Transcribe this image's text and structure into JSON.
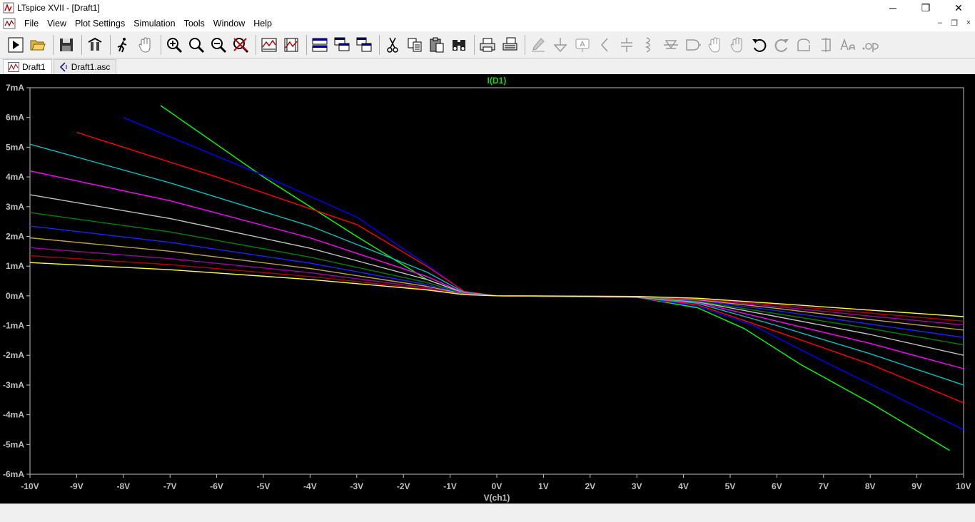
{
  "window": {
    "title": "LTspice XVII - [Draft1]",
    "minimize": "─",
    "maximize": "❐",
    "close": "✕"
  },
  "menubar": {
    "items": [
      "File",
      "View",
      "Plot Settings",
      "Simulation",
      "Tools",
      "Window",
      "Help"
    ],
    "mdi_min": "–",
    "mdi_restore": "❐",
    "mdi_close": "×"
  },
  "toolbar": {
    "icons": [
      "run-icon",
      "open-icon",
      "save-icon",
      "control-panel-icon",
      "halt-icon",
      "pan-icon",
      "zoom-in-icon",
      "zoom-area-icon",
      "zoom-out-icon",
      "zoom-fit-icon",
      "autorange-icon",
      "manual-limits-icon",
      "tile-horizontal-icon",
      "cascade-icon",
      "tile-vertical-icon",
      "cut-icon",
      "copy-icon",
      "paste-icon",
      "find-icon",
      "print-icon",
      "print-setup-icon",
      "wire-icon",
      "ground-icon",
      "label-icon",
      "resistor-icon",
      "capacitor-icon",
      "inductor-icon",
      "diode-icon",
      "component-icon",
      "move-icon",
      "drag-icon",
      "undo-icon",
      "redo-icon",
      "rotate-icon",
      "mirror-icon",
      "text-icon",
      "spice-directive-icon"
    ]
  },
  "tabs": [
    {
      "label": "Draft1",
      "icon": "waveform-icon",
      "active": true
    },
    {
      "label": "Draft1.asc",
      "icon": "schematic-icon",
      "active": false
    }
  ],
  "colors": {
    "background": "#000000",
    "axis": "#c0c0c0",
    "trace_label": "#1fcf1f"
  },
  "chart_data": {
    "type": "line",
    "title": "I(D1)",
    "xlabel": "V(ch1)",
    "ylabel": "",
    "xlim": [
      -10,
      10
    ],
    "ylim": [
      -6,
      7
    ],
    "x_ticks": [
      "-10V",
      "-9V",
      "-8V",
      "-7V",
      "-6V",
      "-5V",
      "-4V",
      "-3V",
      "-2V",
      "-1V",
      "0V",
      "1V",
      "2V",
      "3V",
      "4V",
      "5V",
      "6V",
      "7V",
      "8V",
      "9V",
      "10V"
    ],
    "y_ticks": [
      "7mA",
      "6mA",
      "5mA",
      "4mA",
      "3mA",
      "2mA",
      "1mA",
      "0mA",
      "-1mA",
      "-2mA",
      "-3mA",
      "-4mA",
      "-5mA",
      "-6mA"
    ],
    "grid": false,
    "series": [
      {
        "color": "#00ff00",
        "points": [
          [
            -7.2,
            6.4
          ],
          [
            -5,
            4.0
          ],
          [
            -3,
            2.0
          ],
          [
            -1.5,
            0.55
          ],
          [
            -0.7,
            0.1
          ],
          [
            0,
            0
          ],
          [
            3,
            -0.05
          ],
          [
            4.3,
            -0.4
          ],
          [
            5.3,
            -1.1
          ],
          [
            6.5,
            -2.3
          ],
          [
            8,
            -3.6
          ],
          [
            9.7,
            -5.2
          ]
        ]
      },
      {
        "color": "#0000ff",
        "points": [
          [
            -8,
            6.0
          ],
          [
            -5,
            4.05
          ],
          [
            -3,
            2.65
          ],
          [
            -1.5,
            1.05
          ],
          [
            -0.7,
            0.15
          ],
          [
            0,
            0
          ],
          [
            3,
            -0.05
          ],
          [
            4.3,
            -0.35
          ],
          [
            5.5,
            -1.0
          ],
          [
            7,
            -2.2
          ],
          [
            10,
            -4.5
          ]
        ]
      },
      {
        "color": "#ff0000",
        "points": [
          [
            -9,
            5.5
          ],
          [
            -6,
            4.0
          ],
          [
            -3,
            2.4
          ],
          [
            -1.5,
            1.0
          ],
          [
            -0.7,
            0.15
          ],
          [
            0,
            0
          ],
          [
            3,
            -0.05
          ],
          [
            4.3,
            -0.3
          ],
          [
            6,
            -1.2
          ],
          [
            8,
            -2.3
          ],
          [
            10,
            -3.6
          ]
        ]
      },
      {
        "color": "#00c0c0",
        "points": [
          [
            -10,
            5.1
          ],
          [
            -7,
            3.8
          ],
          [
            -4,
            2.35
          ],
          [
            -1.5,
            0.8
          ],
          [
            -0.7,
            0.12
          ],
          [
            0,
            0
          ],
          [
            3,
            -0.05
          ],
          [
            4.3,
            -0.25
          ],
          [
            6,
            -1.0
          ],
          [
            8,
            -1.95
          ],
          [
            10,
            -3.0
          ]
        ]
      },
      {
        "color": "#ff00ff",
        "points": [
          [
            -10,
            4.2
          ],
          [
            -7,
            3.2
          ],
          [
            -4,
            1.95
          ],
          [
            -1.5,
            0.65
          ],
          [
            -0.7,
            0.1
          ],
          [
            0,
            0
          ],
          [
            3,
            -0.04
          ],
          [
            4.3,
            -0.22
          ],
          [
            6,
            -0.85
          ],
          [
            8,
            -1.6
          ],
          [
            10,
            -2.45
          ]
        ]
      },
      {
        "color": "#c0c0c0",
        "points": [
          [
            -10,
            3.4
          ],
          [
            -7,
            2.6
          ],
          [
            -4,
            1.6
          ],
          [
            -1.5,
            0.55
          ],
          [
            -0.7,
            0.09
          ],
          [
            0,
            0
          ],
          [
            3,
            -0.04
          ],
          [
            4.3,
            -0.2
          ],
          [
            6,
            -0.7
          ],
          [
            8,
            -1.3
          ],
          [
            10,
            -2.0
          ]
        ]
      },
      {
        "color": "#008000",
        "points": [
          [
            -10,
            2.8
          ],
          [
            -7,
            2.15
          ],
          [
            -4,
            1.3
          ],
          [
            -1.5,
            0.45
          ],
          [
            -0.7,
            0.08
          ],
          [
            0,
            0
          ],
          [
            3,
            -0.03
          ],
          [
            4.3,
            -0.18
          ],
          [
            6,
            -0.6
          ],
          [
            8,
            -1.1
          ],
          [
            10,
            -1.65
          ]
        ]
      },
      {
        "color": "#2020ff",
        "points": [
          [
            -10,
            2.35
          ],
          [
            -7,
            1.8
          ],
          [
            -4,
            1.1
          ],
          [
            -1.5,
            0.38
          ],
          [
            -0.7,
            0.07
          ],
          [
            0,
            0
          ],
          [
            3,
            -0.03
          ],
          [
            4.3,
            -0.15
          ],
          [
            6,
            -0.5
          ],
          [
            8,
            -0.95
          ],
          [
            10,
            -1.4
          ]
        ]
      },
      {
        "color": "#c0a040",
        "points": [
          [
            -10,
            1.95
          ],
          [
            -7,
            1.5
          ],
          [
            -4,
            0.92
          ],
          [
            -1.5,
            0.32
          ],
          [
            -0.7,
            0.06
          ],
          [
            0,
            0
          ],
          [
            3,
            -0.03
          ],
          [
            4.3,
            -0.13
          ],
          [
            6,
            -0.42
          ],
          [
            8,
            -0.8
          ],
          [
            10,
            -1.15
          ]
        ]
      },
      {
        "color": "#a000a0",
        "points": [
          [
            -10,
            1.62
          ],
          [
            -7,
            1.25
          ],
          [
            -4,
            0.78
          ],
          [
            -1.5,
            0.27
          ],
          [
            -0.7,
            0.05
          ],
          [
            0,
            0
          ],
          [
            3,
            -0.02
          ],
          [
            4.3,
            -0.11
          ],
          [
            6,
            -0.36
          ],
          [
            8,
            -0.68
          ],
          [
            10,
            -0.98
          ]
        ]
      },
      {
        "color": "#b00000",
        "points": [
          [
            -10,
            1.35
          ],
          [
            -7,
            1.05
          ],
          [
            -4,
            0.65
          ],
          [
            -1.5,
            0.23
          ],
          [
            -0.7,
            0.04
          ],
          [
            0,
            0
          ],
          [
            3,
            -0.02
          ],
          [
            4.3,
            -0.1
          ],
          [
            6,
            -0.3
          ],
          [
            8,
            -0.58
          ],
          [
            10,
            -0.85
          ]
        ]
      },
      {
        "color": "#ffff40",
        "points": [
          [
            -10,
            1.12
          ],
          [
            -7,
            0.88
          ],
          [
            -4,
            0.55
          ],
          [
            -1.5,
            0.2
          ],
          [
            -0.7,
            0.04
          ],
          [
            0,
            0
          ],
          [
            3,
            -0.02
          ],
          [
            4.3,
            -0.08
          ],
          [
            6,
            -0.26
          ],
          [
            8,
            -0.48
          ],
          [
            10,
            -0.7
          ]
        ]
      }
    ]
  }
}
